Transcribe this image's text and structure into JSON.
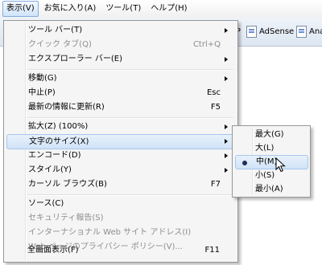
{
  "menubar": {
    "items": [
      {
        "label": "表示(V)"
      },
      {
        "label": "お気に入り(A)"
      },
      {
        "label": "ツール(T)"
      },
      {
        "label": "ヘルプ(H)"
      }
    ]
  },
  "favorites": {
    "items": [
      {
        "label": "AP"
      },
      {
        "label": "AdSense"
      },
      {
        "label": "Ana"
      }
    ]
  },
  "view_menu": {
    "items": [
      {
        "label": "ツール バー(T)",
        "shortcut": "",
        "submenu": true,
        "disabled": false
      },
      {
        "label": "クイック タブ(Q)",
        "shortcut": "Ctrl+Q",
        "submenu": false,
        "disabled": true
      },
      {
        "label": "エクスプローラー バー(E)",
        "shortcut": "",
        "submenu": true,
        "disabled": false
      },
      {
        "label": "移動(G)",
        "shortcut": "",
        "submenu": true,
        "disabled": false
      },
      {
        "label": "中止(P)",
        "shortcut": "Esc",
        "submenu": false,
        "disabled": false
      },
      {
        "label": "最新の情報に更新(R)",
        "shortcut": "F5",
        "submenu": false,
        "disabled": false
      },
      {
        "label": "拡大(Z) (100%)",
        "shortcut": "",
        "submenu": true,
        "disabled": false
      },
      {
        "label": "文字のサイズ(X)",
        "shortcut": "",
        "submenu": true,
        "disabled": false
      },
      {
        "label": "エンコード(D)",
        "shortcut": "",
        "submenu": true,
        "disabled": false
      },
      {
        "label": "スタイル(Y)",
        "shortcut": "",
        "submenu": true,
        "disabled": false
      },
      {
        "label": "カーソル ブラウズ(B)",
        "shortcut": "F7",
        "submenu": false,
        "disabled": false
      },
      {
        "label": "ソース(C)",
        "shortcut": "",
        "submenu": false,
        "disabled": false
      },
      {
        "label": "セキュリティ報告(S)",
        "shortcut": "",
        "submenu": false,
        "disabled": true
      },
      {
        "label": "インターナショナル Web サイト アドレス(I)",
        "shortcut": "",
        "submenu": false,
        "disabled": true
      },
      {
        "label": "Web ページのプライバシー ポリシー(V)...",
        "shortcut": "",
        "submenu": false,
        "disabled": true
      },
      {
        "label": "全画面表示(F)",
        "shortcut": "F11",
        "submenu": false,
        "disabled": false
      }
    ]
  },
  "text_size_menu": {
    "items": [
      {
        "label": "最大(G)",
        "selected": false
      },
      {
        "label": "大(L)",
        "selected": false
      },
      {
        "label": "中(M)",
        "selected": true
      },
      {
        "label": "小(S)",
        "selected": false
      },
      {
        "label": "最小(A)",
        "selected": false
      }
    ]
  },
  "colors": {
    "highlight_border": "#a8c7ec",
    "disabled_text": "#8d8d8d",
    "menu_bg": "#f5f5f5"
  }
}
